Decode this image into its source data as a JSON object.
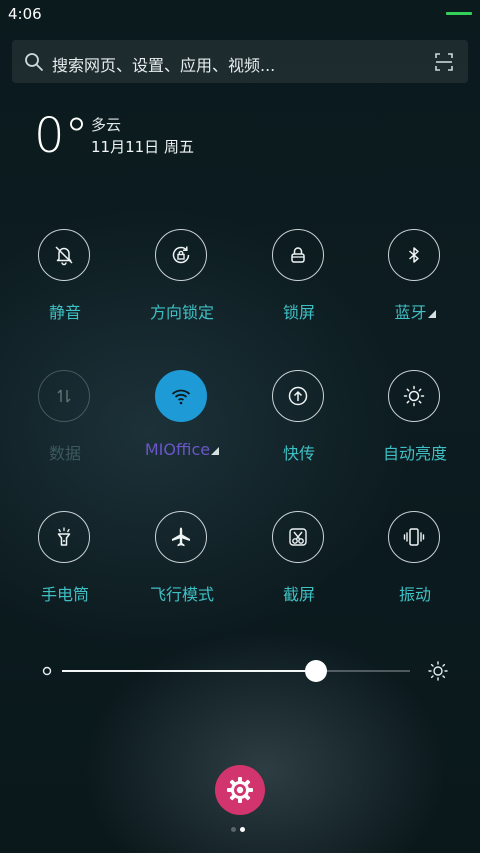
{
  "status_bar": {
    "time": "4:06",
    "battery_color": "#33d05a"
  },
  "search": {
    "placeholder": "搜索网页、设置、应用、视频...",
    "icon": "search-icon",
    "scan_icon": "scan-icon"
  },
  "weather": {
    "temperature": "0°",
    "condition": "多云",
    "date": "11月11日 周五"
  },
  "toggles": [
    {
      "id": "mute",
      "label": "静音",
      "icon": "bell-off-icon",
      "state": "off"
    },
    {
      "id": "rotation-lock",
      "label": "方向锁定",
      "icon": "rotation-lock-icon",
      "state": "off"
    },
    {
      "id": "lock-screen",
      "label": "锁屏",
      "icon": "lock-icon",
      "state": "off"
    },
    {
      "id": "bluetooth",
      "label": "蓝牙",
      "icon": "bluetooth-icon",
      "state": "off",
      "expandable": true
    },
    {
      "id": "mobile-data",
      "label": "数据",
      "icon": "data-arrows-icon",
      "state": "disabled"
    },
    {
      "id": "wifi",
      "label": "MIOffice",
      "icon": "wifi-icon",
      "state": "on",
      "expandable": true
    },
    {
      "id": "quick-share",
      "label": "快传",
      "icon": "upload-icon",
      "state": "off"
    },
    {
      "id": "auto-brightness",
      "label": "自动亮度",
      "icon": "sun-icon",
      "state": "off"
    },
    {
      "id": "flashlight",
      "label": "手电筒",
      "icon": "flashlight-icon",
      "state": "off"
    },
    {
      "id": "airplane",
      "label": "飞行模式",
      "icon": "airplane-icon",
      "state": "off"
    },
    {
      "id": "screenshot",
      "label": "截屏",
      "icon": "scissors-icon",
      "state": "off"
    },
    {
      "id": "vibrate",
      "label": "振动",
      "icon": "vibrate-icon",
      "state": "off"
    }
  ],
  "brightness": {
    "level_percent": 73
  },
  "settings_button": {
    "icon": "gear-icon",
    "color": "#d2356e"
  },
  "pager": {
    "total_pages": 2,
    "current_page": 2
  },
  "colors": {
    "toggle_label": "#3fc0c4",
    "toggle_active": "#1e9bd6",
    "wifi_label": "#6a56c8"
  }
}
